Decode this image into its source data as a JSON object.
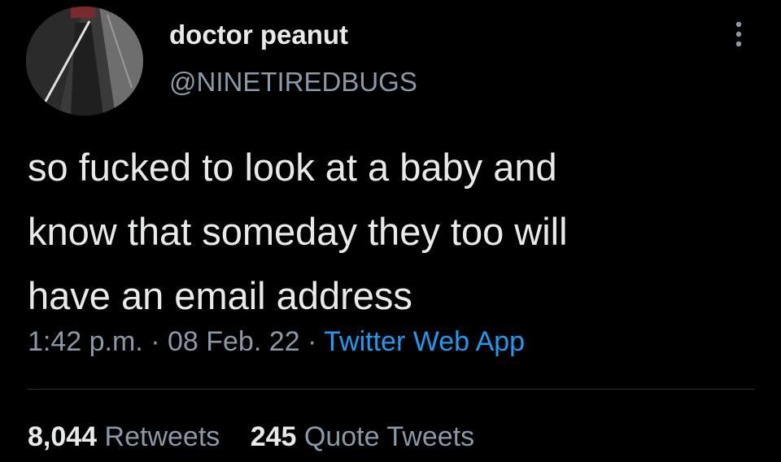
{
  "author": {
    "display_name": "doctor peanut",
    "handle": "@NINETIREDBUGS",
    "avatar_icon": "profile-photo"
  },
  "more_icon": "more-vertical-icon",
  "tweet": {
    "text": "so fucked to look at a baby and\nknow that someday they too will\nhave an email address"
  },
  "meta": {
    "time": "1:42 p.m.",
    "separator": " · ",
    "date": "08 Feb. 22",
    "source": "Twitter Web App"
  },
  "stats": {
    "retweets_count": "8,044",
    "retweets_label": "Retweets",
    "quotes_count": "245",
    "quotes_label": "Quote Tweets"
  },
  "colors": {
    "background": "#000000",
    "primary_text": "#e7e9ea",
    "secondary_text": "#8b98a5",
    "link": "#1d9bf0",
    "divider": "#2f3336"
  }
}
